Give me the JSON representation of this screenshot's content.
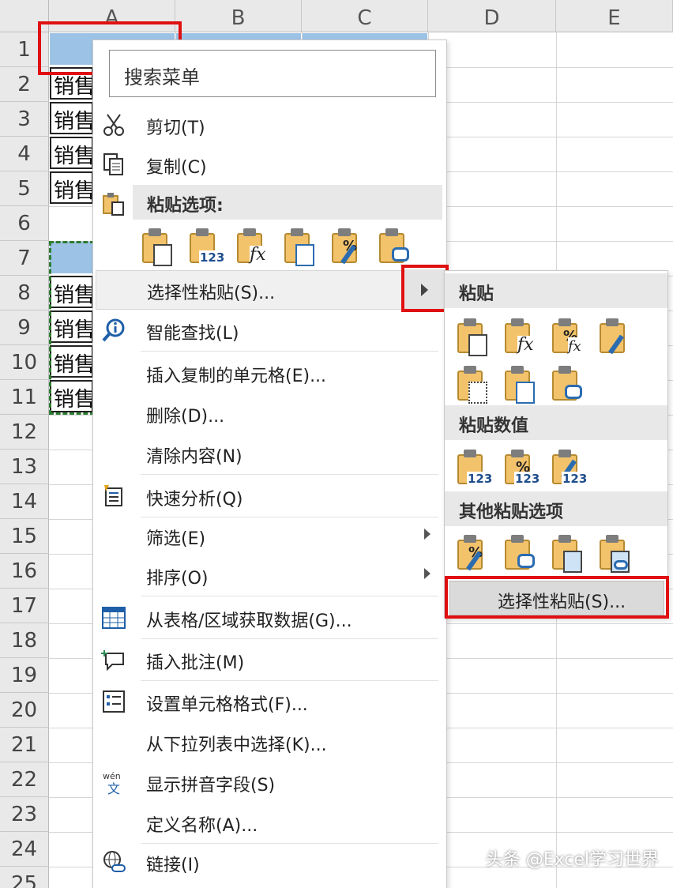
{
  "sheet": {
    "columns": [
      "A",
      "B",
      "C",
      "D",
      "E"
    ],
    "rows": [
      "1",
      "2",
      "3",
      "4",
      "5",
      "6",
      "7",
      "8",
      "9",
      "10",
      "11",
      "12",
      "13",
      "14",
      "15",
      "16",
      "17",
      "18",
      "19",
      "20",
      "21",
      "22",
      "23",
      "24",
      "25"
    ],
    "cell_text_rows_2_5": [
      "销售",
      "销售",
      "销售",
      "销售"
    ],
    "cell_text_rows_8_11": [
      "销售",
      "销售",
      "销售",
      "销售"
    ]
  },
  "context_menu": {
    "search_placeholder": "搜索菜单",
    "cut": "剪切(T)",
    "copy": "复制(C)",
    "paste_options_header": "粘贴选项:",
    "paste_special": "选择性粘贴(S)...",
    "smart_lookup": "智能查找(L)",
    "insert_copied_cells": "插入复制的单元格(E)...",
    "delete": "删除(D)...",
    "clear_contents": "清除内容(N)",
    "quick_analysis": "快速分析(Q)",
    "filter": "筛选(E)",
    "sort": "排序(O)",
    "get_data_from_table": "从表格/区域获取数据(G)...",
    "insert_comment": "插入批注(M)",
    "format_cells": "设置单元格格式(F)...",
    "pick_from_dropdown": "从下拉列表中选择(K)...",
    "show_phonetic": "显示拼音字段(S)",
    "define_name": "定义名称(A)...",
    "link": "链接(I)"
  },
  "submenu": {
    "paste_header": "粘贴",
    "paste_values_header": "粘贴数值",
    "other_paste_header": "其他粘贴选项",
    "paste_special_button": "选择性粘贴(S)..."
  },
  "icon_tags": {
    "values": "123",
    "percent": "%",
    "fx": "fx"
  },
  "watermark": "头条 @Excel学习世界",
  "colors": {
    "header_blue": "#9cc3e6",
    "highlight_red": "#e01010",
    "selection_green": "#2e7d32"
  }
}
